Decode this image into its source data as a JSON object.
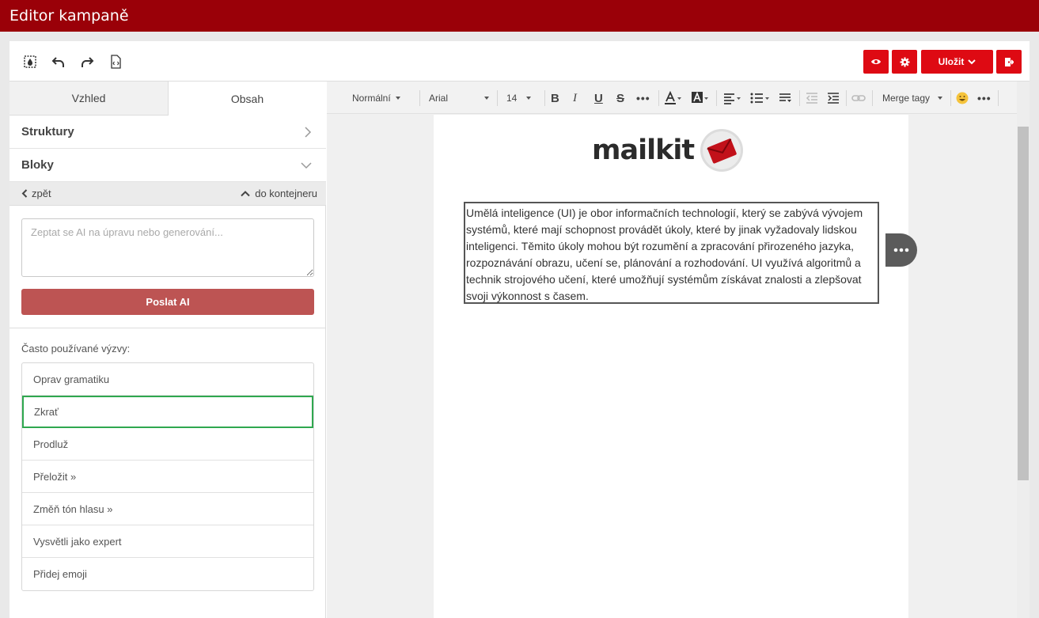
{
  "app": {
    "title": "Editor kampaně"
  },
  "topbar": {
    "icons": [
      "design-icon",
      "undo-icon",
      "redo-icon",
      "html-code-icon"
    ],
    "save_label": "Uložit",
    "buttons": [
      "eye-icon",
      "gear-icon",
      "exit-icon"
    ],
    "accent": "#de0a13"
  },
  "tabs": [
    {
      "label": "Vzhled"
    },
    {
      "label": "Obsah"
    }
  ],
  "accordion": {
    "structures": "Struktury",
    "blocks": "Bloky"
  },
  "nav": {
    "back": "zpět",
    "to_container": "do kontejneru"
  },
  "ai": {
    "placeholder": "Zeptat se AI na úpravu nebo generování...",
    "value": "",
    "send_label": "Poslat AI",
    "send_color": "#bd5453"
  },
  "prompts": {
    "title": "Často používané výzvy:",
    "items": [
      "Oprav gramatiku",
      "Zkrať",
      "Prodluž",
      "Přeložit »",
      "Změň tón hlasu »",
      "Vysvětli jako expert",
      "Přidej emoji"
    ],
    "selected": "Zkrať"
  },
  "toolbar": {
    "format": "Normální",
    "font": "Arial",
    "size": "14",
    "merge_tags": "Merge tagy"
  },
  "canvas": {
    "logo_text": "mailkit",
    "paragraph": "Umělá inteligence (UI) je obor informačních technologií, který se zabývá vývojem systémů, které mají schopnost provádět úkoly, které by jinak vyžadovaly lidskou inteligenci. Těmito úkoly mohou být rozumění a zpracování přirozeného jazyka, rozpoznávání obrazu, učení se, plánování a rozhodování. UI využívá algoritmů a technik strojového učení, které umožňují systémům získávat znalosti a zlepšovat svoji výkonnost s časem."
  }
}
